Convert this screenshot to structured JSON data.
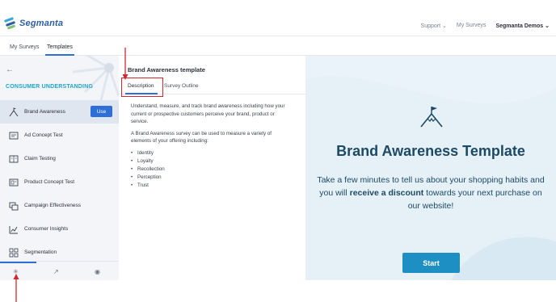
{
  "brand": {
    "name": "Segmanta"
  },
  "topnav": {
    "support": "Support",
    "my_surveys": "My Surveys",
    "account": "Segmanta Demos"
  },
  "subnav": {
    "my_surveys": "My Surveys",
    "templates": "Templates"
  },
  "sidebar": {
    "title": "CONSUMER UNDERSTANDING",
    "use_label": "Use",
    "items": [
      {
        "label": "Brand Awareness",
        "icon": "mountain-flag-icon"
      },
      {
        "label": "Ad Concept Test",
        "icon": "ad-icon"
      },
      {
        "label": "Claim Testing",
        "icon": "document-icon"
      },
      {
        "label": "Product Concept Test",
        "icon": "product-icon"
      },
      {
        "label": "Campaign Effectiveness",
        "icon": "campaign-icon"
      },
      {
        "label": "Consumer Insights",
        "icon": "insights-icon"
      },
      {
        "label": "Segmentation",
        "icon": "segmentation-icon"
      }
    ]
  },
  "template": {
    "title": "Brand Awareness template",
    "tabs": {
      "description": "Description",
      "outline": "Survey Outline"
    },
    "desc_p1": "Understand, measure, and track brand awareness including how your current or prospective customers perceive your brand, product or service.",
    "desc_p2": "A Brand Awareness survey can be used to measure a variety of elements of your offering including:",
    "bullets": [
      "Identity",
      "Loyalty",
      "Recollection",
      "Perception",
      "Trust"
    ]
  },
  "preview": {
    "title": "Brand Awareness Template",
    "text_before": "Take a few minutes to tell us about your shopping habits and you will ",
    "text_bold": "receive a discount",
    "text_after": " towards your next purchase on our website!",
    "start": "Start"
  },
  "colors": {
    "accent": "#2d6fd6",
    "annotation": "#d0282f",
    "preview_title": "#1c4a64"
  }
}
